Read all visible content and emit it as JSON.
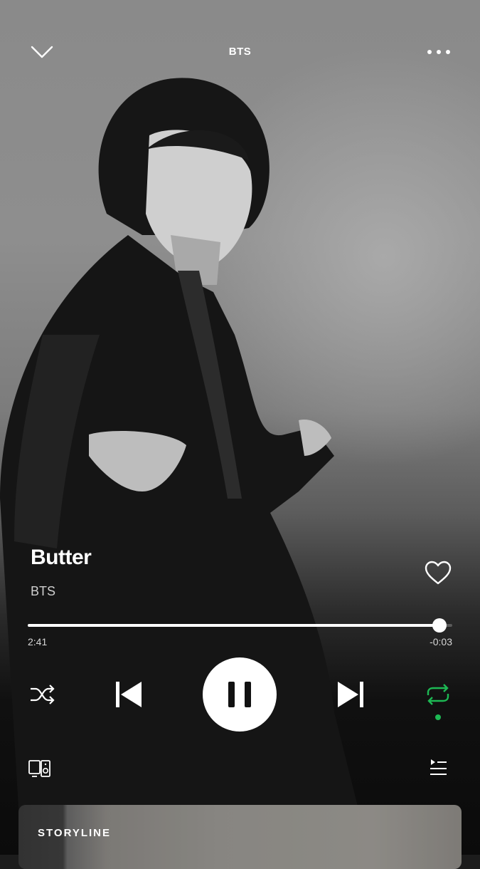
{
  "header": {
    "title": "BTS",
    "collapse_icon": "chevron-down-icon",
    "more_icon": "more-horizontal-icon"
  },
  "track": {
    "title": "Butter",
    "artist": "BTS",
    "liked": false
  },
  "playback": {
    "elapsed": "2:41",
    "remaining": "-0:03",
    "progress_fraction": 0.97,
    "state": "playing",
    "shuffle": false,
    "repeat": true
  },
  "colors": {
    "accent": "#1db954",
    "text": "#ffffff"
  },
  "footer": {
    "devices_icon": "connect-devices-icon",
    "queue_icon": "queue-icon"
  },
  "storyline": {
    "label": "STORYLINE"
  }
}
